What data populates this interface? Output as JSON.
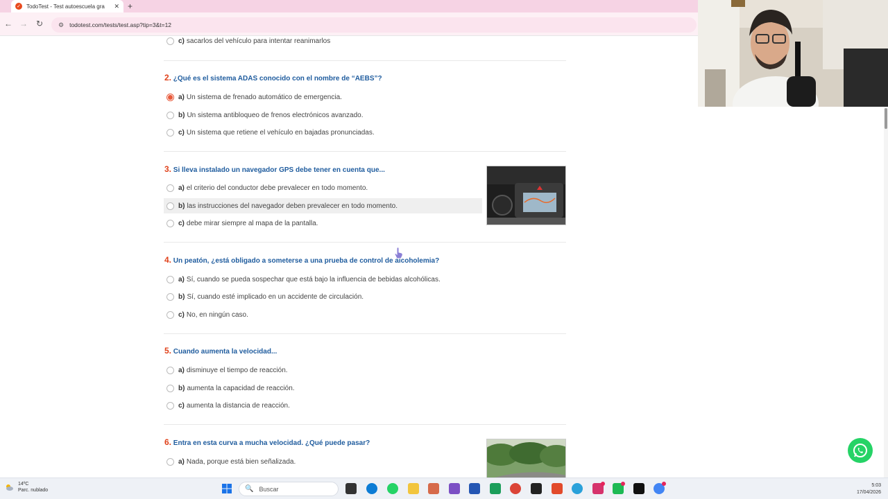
{
  "browser": {
    "tab_title": "TodoTest - Test autoescuela gra",
    "tab_close": "✕",
    "new_tab": "+",
    "url": "todotest.com/tests/test.asp?tip=3&t=12",
    "back": "←",
    "forward": "→",
    "reload": "↻"
  },
  "questions": {
    "prev_option_c": {
      "letter": "c)",
      "text": "sacarlos del vehículo para intentar reanimarlos"
    },
    "q2": {
      "num": "2.",
      "text": "¿Qué es el sistema ADAS conocido con el nombre de “AEBS”?",
      "a": {
        "letter": "a)",
        "text": "Un sistema de frenado automático de emergencia."
      },
      "b": {
        "letter": "b)",
        "text": "Un sistema antibloqueo de frenos electrónicos avanzado."
      },
      "c": {
        "letter": "c)",
        "text": "Un sistema que retiene el vehículo en bajadas pronunciadas."
      }
    },
    "q3": {
      "num": "3.",
      "text": "Si lleva instalado un navegador GPS debe tener en cuenta que...",
      "a": {
        "letter": "a)",
        "text": "el criterio del conductor debe prevalecer en todo momento."
      },
      "b": {
        "letter": "b)",
        "text": "las instrucciones del navegador deben prevalecer en todo momento."
      },
      "c": {
        "letter": "c)",
        "text": "debe mirar siempre al mapa de la pantalla."
      }
    },
    "q4": {
      "num": "4.",
      "text": "Un peatón, ¿está obligado a someterse a una prueba de control de alcoholemia?",
      "a": {
        "letter": "a)",
        "text": "Sí, cuando se pueda sospechar que está bajo la influencia de bebidas alcohólicas."
      },
      "b": {
        "letter": "b)",
        "text": "Sí, cuando esté implicado en un accidente de circulación."
      },
      "c": {
        "letter": "c)",
        "text": "No, en ningún caso."
      }
    },
    "q5": {
      "num": "5.",
      "text": "Cuando aumenta la velocidad...",
      "a": {
        "letter": "a)",
        "text": "disminuye el tiempo de reacción."
      },
      "b": {
        "letter": "b)",
        "text": "aumenta la capacidad de reacción."
      },
      "c": {
        "letter": "c)",
        "text": "aumenta la distancia de reacción."
      }
    },
    "q6": {
      "num": "6.",
      "text": "Entra en esta curva a mucha velocidad. ¿Qué puede pasar?",
      "a": {
        "letter": "a)",
        "text": "Nada, porque está bien señalizada."
      }
    },
    "selected": "q2.a"
  },
  "taskbar": {
    "temperature": "14ºC",
    "weather": "Parc. nublado",
    "search_placeholder": "Buscar",
    "time": "5:03",
    "date": "17/04/2026"
  },
  "colors": {
    "accent": "#e0421b",
    "question_text": "#1f5c9e",
    "tabbar": "#f6d3e4",
    "whatsapp": "#25d366"
  }
}
